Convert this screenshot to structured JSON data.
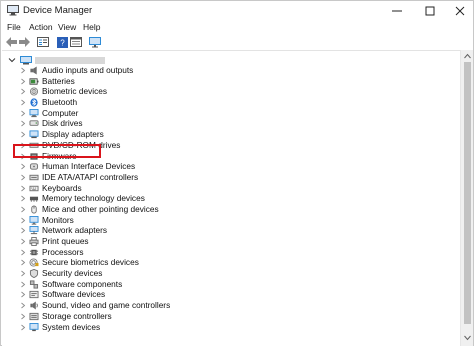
{
  "window": {
    "title": "Device Manager"
  },
  "menu": [
    "File",
    "Action",
    "View",
    "Help"
  ],
  "toolbar": {
    "buttons": [
      "back-icon",
      "forward-icon",
      "properties-icon",
      "help-icon",
      "view-icon",
      "monitor-icon"
    ]
  },
  "tree": {
    "items": [
      {
        "label": "Audio inputs and outputs",
        "icon": "speaker-icon",
        "color": "#6b6b6b"
      },
      {
        "label": "Batteries",
        "icon": "battery-icon",
        "color": "#3c8a3c"
      },
      {
        "label": "Biometric devices",
        "icon": "fingerprint-icon",
        "color": "#7a7a7a"
      },
      {
        "label": "Bluetooth",
        "icon": "bluetooth-icon",
        "color": "#1f6fd1"
      },
      {
        "label": "Computer",
        "icon": "computer-icon",
        "color": "#2e8bd6"
      },
      {
        "label": "Disk drives",
        "icon": "disk-icon",
        "color": "#6b6b6b"
      },
      {
        "label": "Display adapters",
        "icon": "display-icon",
        "color": "#2e8bd6"
      },
      {
        "label": "DVD/CD-ROM drives",
        "icon": "dvd-icon",
        "color": "#6b6b6b"
      },
      {
        "label": "Firmware",
        "icon": "firmware-icon",
        "color": "#555555"
      },
      {
        "label": "Human Interface Devices",
        "icon": "hid-icon",
        "color": "#6b6b6b"
      },
      {
        "label": "IDE ATA/ATAPI controllers",
        "icon": "ide-icon",
        "color": "#6b6b6b"
      },
      {
        "label": "Keyboards",
        "icon": "keyboard-icon",
        "color": "#6b6b6b"
      },
      {
        "label": "Memory technology devices",
        "icon": "memory-icon",
        "color": "#555555"
      },
      {
        "label": "Mice and other pointing devices",
        "icon": "mouse-icon",
        "color": "#6b6b6b"
      },
      {
        "label": "Monitors",
        "icon": "monitor-icon",
        "color": "#2e8bd6"
      },
      {
        "label": "Network adapters",
        "icon": "network-icon",
        "color": "#2e8bd6"
      },
      {
        "label": "Print queues",
        "icon": "printer-icon",
        "color": "#6b6b6b"
      },
      {
        "label": "Processors",
        "icon": "processor-icon",
        "color": "#555555"
      },
      {
        "label": "Secure biometrics devices",
        "icon": "secure-fingerprint-icon",
        "color": "#7a7a7a"
      },
      {
        "label": "Security devices",
        "icon": "security-icon",
        "color": "#6b6b6b"
      },
      {
        "label": "Software components",
        "icon": "software-component-icon",
        "color": "#6b6b6b"
      },
      {
        "label": "Software devices",
        "icon": "software-device-icon",
        "color": "#6b6b6b"
      },
      {
        "label": "Sound, video and game controllers",
        "icon": "sound-icon",
        "color": "#6b6b6b"
      },
      {
        "label": "Storage controllers",
        "icon": "storage-icon",
        "color": "#6b6b6b"
      },
      {
        "label": "System devices",
        "icon": "system-icon",
        "color": "#2e8bd6"
      }
    ]
  },
  "highlight": {
    "target": "Bluetooth",
    "color": "#d9141b"
  }
}
